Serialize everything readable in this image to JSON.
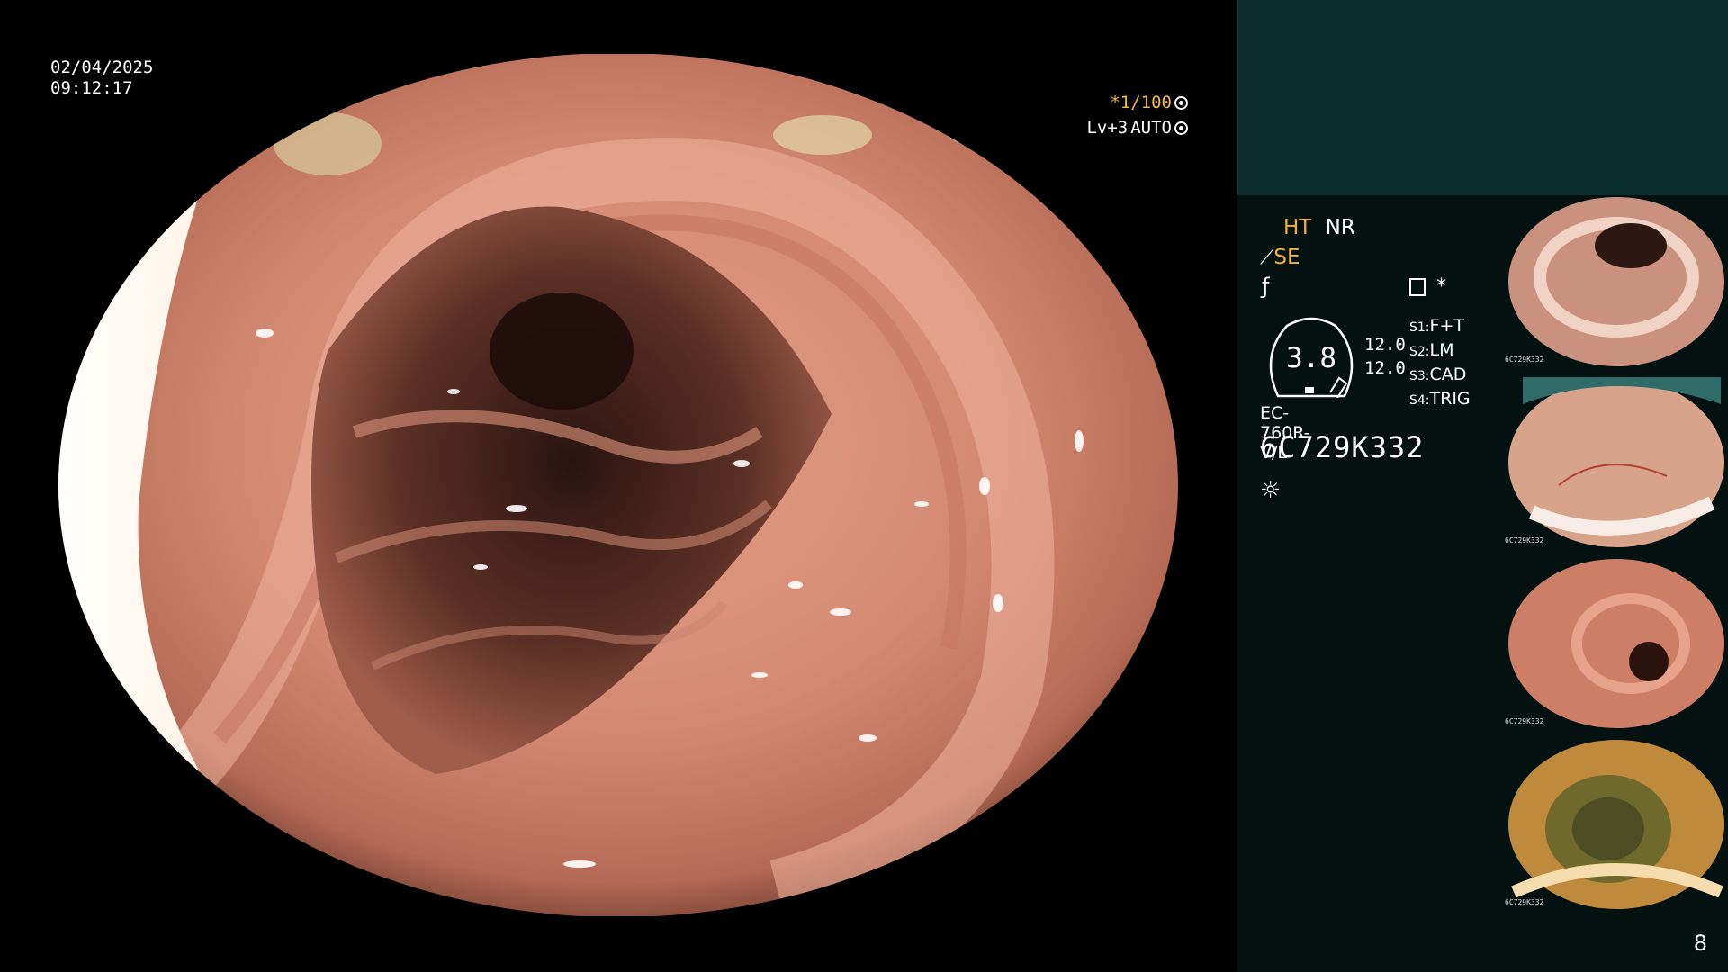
{
  "exam": {
    "date": "02/04/2025",
    "time": "09:12:17"
  },
  "exposure": {
    "shutter": "*1/100",
    "level": "Lv+3",
    "mode": "AUTO"
  },
  "panel": {
    "mode_ht": "HT",
    "mode_nr": "NR",
    "se": "SE",
    "star": "*",
    "gauge_value": "3.8",
    "num1": "12.0",
    "num2": "12.0",
    "settings": [
      {
        "key": "S1",
        "value": "F+T"
      },
      {
        "key": "S2",
        "value": "LM"
      },
      {
        "key": "S3",
        "value": "CAD"
      },
      {
        "key": "S4",
        "value": "TRIG"
      }
    ],
    "scope_model": "EC-760R-V/L",
    "serial": "6C729K332"
  },
  "thumbnails": [
    {
      "caption": "6C729K332",
      "tone": "#c9917e"
    },
    {
      "caption": "6C729K332",
      "tone": "#d7a48b"
    },
    {
      "caption": "6C729K332",
      "tone": "#cc7f66"
    },
    {
      "caption": "6C729K332",
      "tone": "#c08a3d"
    }
  ],
  "page_number": "8",
  "icons": [
    "memo-icon",
    "sun-icon",
    "freeze-icon",
    "scope-icon"
  ]
}
